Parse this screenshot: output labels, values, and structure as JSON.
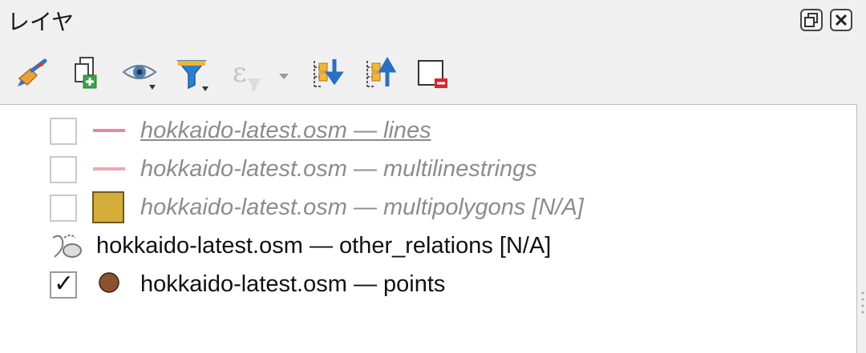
{
  "panel": {
    "title": "レイヤ"
  },
  "window_buttons": [
    {
      "icon": "float-icon"
    },
    {
      "icon": "close-icon"
    }
  ],
  "toolbar": [
    {
      "icon": "style-manager-icon"
    },
    {
      "icon": "add-group-icon"
    },
    {
      "icon": "manage-visibility-icon"
    },
    {
      "icon": "filter-legend-icon"
    },
    {
      "icon": "filter-by-expression-icon"
    },
    {
      "icon": "expand-all-icon"
    },
    {
      "icon": "collapse-all-icon"
    },
    {
      "icon": "remove-layer-icon"
    }
  ],
  "layers": [
    {
      "label": "hokkaido-latest.osm — lines",
      "checked": false,
      "symbol": "line",
      "color": "#e8879c",
      "disabled": true,
      "underline": true
    },
    {
      "label": "hokkaido-latest.osm — multilinestrings",
      "checked": false,
      "symbol": "line",
      "color": "#f0a6b4",
      "disabled": true,
      "underline": false
    },
    {
      "label": "hokkaido-latest.osm — multipolygons [N/A]",
      "checked": false,
      "symbol": "fill",
      "color": "#d4ad3a",
      "disabled": true,
      "underline": false
    },
    {
      "label": "hokkaido-latest.osm — other_relations [N/A]",
      "checked": null,
      "symbol": "geometry",
      "color": "#888888",
      "disabled": false,
      "underline": false
    },
    {
      "label": "hokkaido-latest.osm — points",
      "checked": true,
      "symbol": "point",
      "color": "#8b5230",
      "disabled": false,
      "underline": false
    }
  ]
}
